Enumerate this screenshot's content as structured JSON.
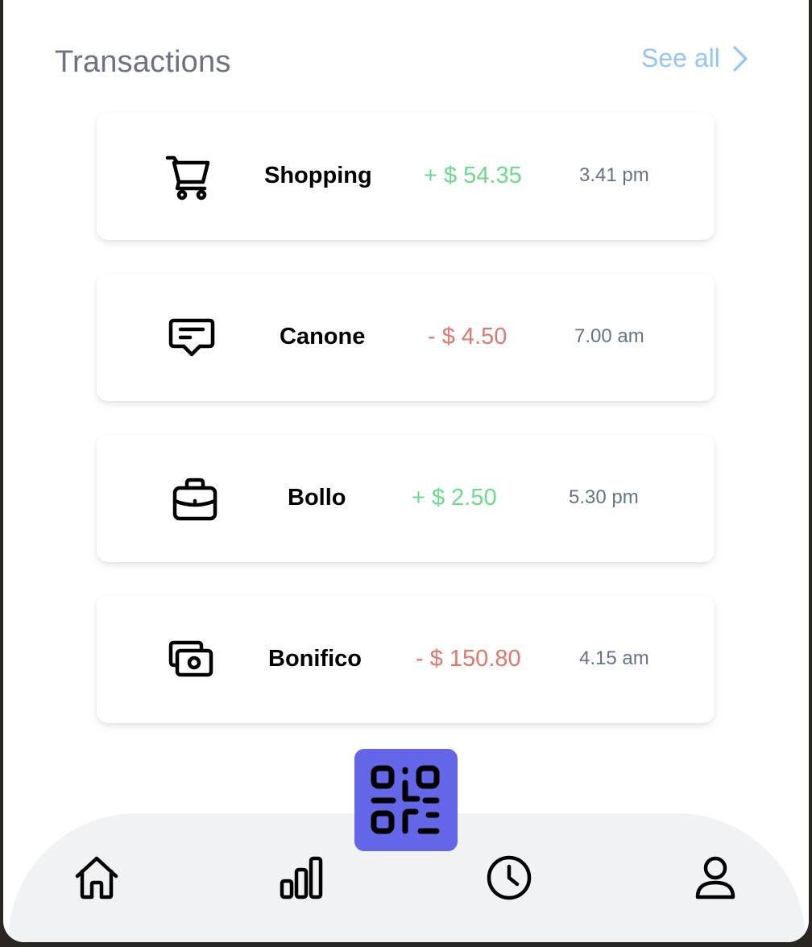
{
  "header": {
    "title": "Transactions",
    "see_all_label": "See all"
  },
  "transactions": [
    {
      "icon": "shopping-cart-icon",
      "name": "Shopping",
      "amount": "+ $ 54.35",
      "direction": "credit",
      "time": "3.41 pm"
    },
    {
      "icon": "message-icon",
      "name": "Canone",
      "amount": "- $ 4.50",
      "direction": "debit",
      "time": "7.00 am"
    },
    {
      "icon": "briefcase-icon",
      "name": "Bollo",
      "amount": "+ $ 2.50",
      "direction": "credit",
      "time": "5.30 pm"
    },
    {
      "icon": "cash-icon",
      "name": "Bonifico",
      "amount": "- $ 150.80",
      "direction": "debit",
      "time": "4.15 am"
    }
  ],
  "bottom_nav": {
    "items": [
      "home-icon",
      "chart-bar-icon",
      "clock-icon",
      "user-icon"
    ],
    "center_action": "qr-code-icon"
  },
  "colors": {
    "title": "#6b7280",
    "link": "#93c5fd",
    "credit": "#6bdb8b",
    "debit": "#e2776d",
    "time": "#64748b",
    "qr_button": "#6366e6",
    "nav_bar": "#f1f2f4"
  }
}
